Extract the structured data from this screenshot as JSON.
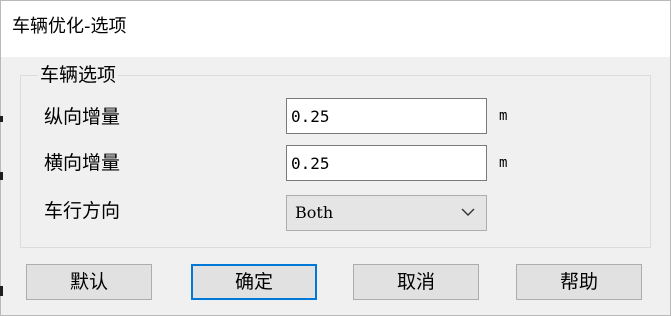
{
  "dialog": {
    "title": "车辆优化-选项"
  },
  "group": {
    "label": "车辆选项",
    "rows": [
      {
        "label": "纵向增量",
        "value": "0.25",
        "unit": "m"
      },
      {
        "label": "横向增量",
        "value": "0.25",
        "unit": "m"
      },
      {
        "label": "车行方向",
        "selected": "Both"
      }
    ]
  },
  "buttons": {
    "default_label": "默认",
    "ok_label": "确定",
    "cancel_label": "取消",
    "help_label": "帮助"
  },
  "colors": {
    "focus_border": "#0078d7",
    "dialog_background": "#f0f0f0"
  }
}
